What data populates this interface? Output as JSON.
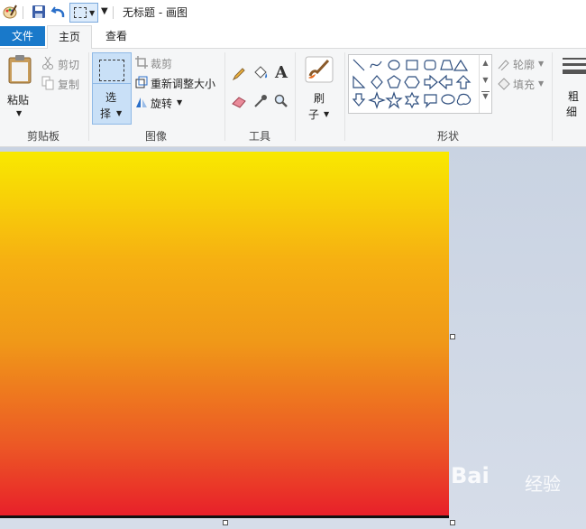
{
  "window": {
    "title": "无标题 - 画图"
  },
  "tabs": {
    "file": "文件",
    "home": "主页",
    "view": "查看"
  },
  "clipboard": {
    "paste": "粘贴",
    "cut": "剪切",
    "copy": "复制",
    "group": "剪贴板"
  },
  "image": {
    "select_top": "选",
    "select_bottom": "择",
    "crop": "裁剪",
    "resize": "重新调整大小",
    "rotate": "旋转",
    "group": "图像"
  },
  "tools": {
    "group": "工具"
  },
  "brush": {
    "top": "刷",
    "bottom": "子"
  },
  "shapes": {
    "outline": "轮廓",
    "fill": "填充",
    "group": "形状"
  },
  "size": {
    "top": "粗",
    "bottom": "细"
  },
  "watermark": {
    "brand": "Bai",
    "suffix": "经验"
  },
  "colors": {
    "accent": "#1979ca",
    "selected_bg": "#c9e0f7"
  }
}
